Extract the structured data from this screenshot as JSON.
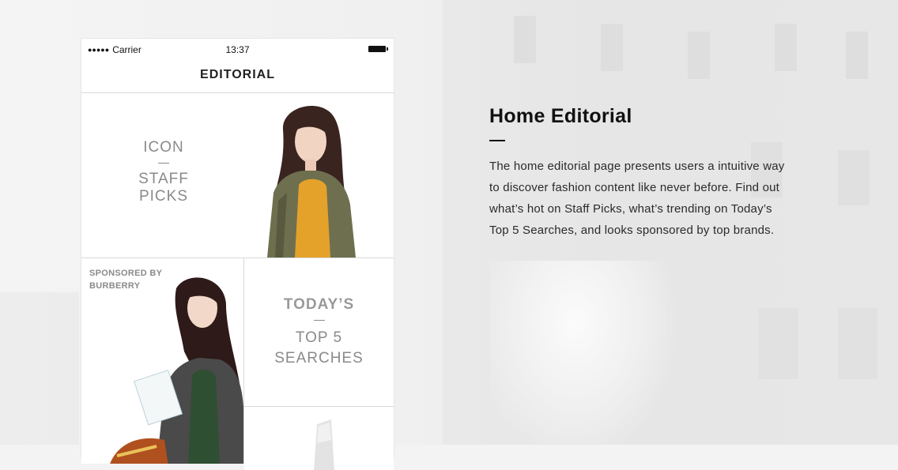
{
  "status_bar": {
    "signal": "●●●●●",
    "carrier": "Carrier",
    "time": "13:37"
  },
  "nav": {
    "title": "EDITORIAL"
  },
  "cards": {
    "staff": {
      "line1": "ICON",
      "line2": "STAFF PICKS"
    },
    "sponsor": {
      "line1": "SPONSORED BY",
      "line2": "BURBERRY"
    },
    "top5": {
      "line1": "TODAY’S",
      "line2": "TOP 5",
      "line3": "SEARCHES"
    }
  },
  "info": {
    "heading": "Home Editorial",
    "body": "The home editorial page presents users a intuitive way to discover fashion content like never before. Find out what’s hot on Staff Picks, what’s trending on Today’s Top 5 Searches, and looks sponsored by top brands."
  },
  "colors": {
    "background": "#f3f3f3",
    "card": "#ffffff",
    "divider": "#d9d9d9",
    "muted_text": "#8a8a8a",
    "heading": "#111111"
  }
}
